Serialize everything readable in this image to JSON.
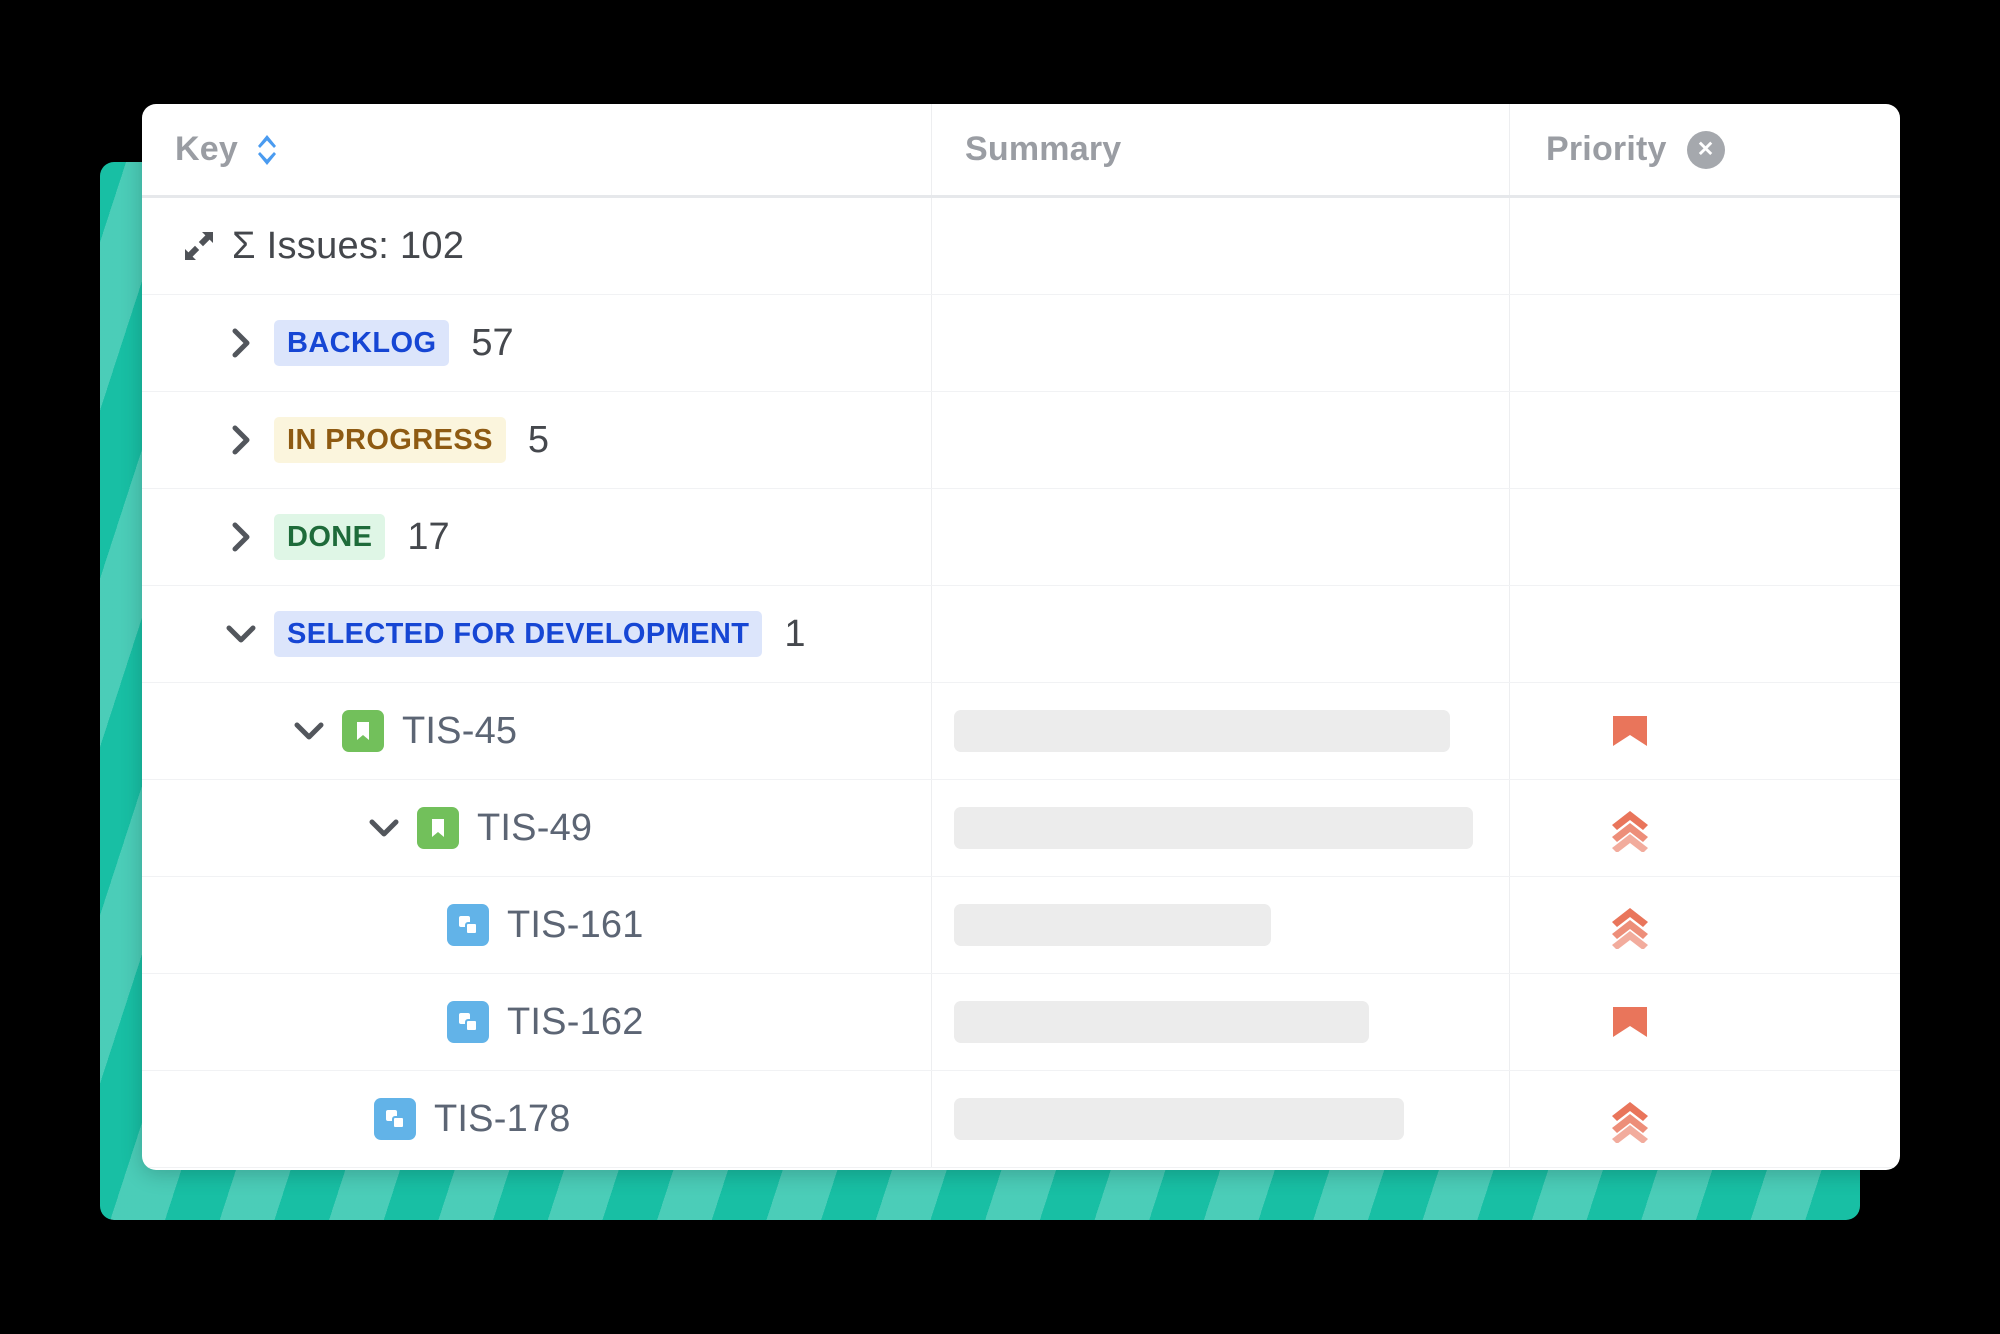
{
  "columns": {
    "key": {
      "label": "Key",
      "sort_icon": "sort-updown-icon"
    },
    "summary": {
      "label": "Summary"
    },
    "priority": {
      "label": "Priority",
      "clear_icon": "close-circle-icon",
      "clear_glyph": "✕"
    }
  },
  "summary_row": {
    "expand_icon": "expand-diagonal-icon",
    "label": "Σ Issues: 102",
    "sigma": "Σ",
    "text": "Issues:",
    "total": "102"
  },
  "status_groups": [
    {
      "name": "BACKLOG",
      "count": "57",
      "expanded": false,
      "chevron": "chevron-right-icon",
      "bg": "#DCE5FB",
      "fg": "#1646D4"
    },
    {
      "name": "IN PROGRESS",
      "count": "5",
      "expanded": false,
      "chevron": "chevron-right-icon",
      "bg": "#FBF5DD",
      "fg": "#8E5A12"
    },
    {
      "name": "DONE",
      "count": "17",
      "expanded": false,
      "chevron": "chevron-right-icon",
      "bg": "#DFF6E6",
      "fg": "#1E6B3A"
    },
    {
      "name": "SELECTED FOR DEVELOPMENT",
      "count": "1",
      "expanded": true,
      "chevron": "chevron-down-icon",
      "bg": "#DCE5FB",
      "fg": "#1646D4"
    }
  ],
  "issues": [
    {
      "key": "TIS-45",
      "type": "story",
      "type_icon": "story-bookmark-icon",
      "indent": 1,
      "chevron": "chevron-down-icon",
      "has_chevron": true,
      "summary_width_pct": 86,
      "priority": "highest",
      "priority_icon": "priority-highest-icon"
    },
    {
      "key": "TIS-49",
      "type": "story",
      "type_icon": "story-bookmark-icon",
      "indent": 2,
      "chevron": "chevron-down-icon",
      "has_chevron": true,
      "summary_width_pct": 90,
      "priority": "high",
      "priority_icon": "priority-high-icon"
    },
    {
      "key": "TIS-161",
      "type": "subtask",
      "type_icon": "subtask-squares-icon",
      "indent": 3,
      "chevron": "",
      "has_chevron": false,
      "summary_width_pct": 55,
      "priority": "high",
      "priority_icon": "priority-high-icon"
    },
    {
      "key": "TIS-162",
      "type": "subtask",
      "type_icon": "subtask-squares-icon",
      "indent": 3,
      "chevron": "",
      "has_chevron": false,
      "summary_width_pct": 72,
      "priority": "highest",
      "priority_icon": "priority-highest-icon"
    },
    {
      "key": "TIS-178",
      "type": "subtask",
      "type_icon": "subtask-squares-icon",
      "indent": 2,
      "chevron": "",
      "has_chevron": false,
      "summary_width_pct": 78,
      "priority": "high",
      "priority_icon": "priority-high-icon"
    }
  ],
  "colors": {
    "accent_teal": "#18BFA4",
    "story_green": "#72C05B",
    "subtask_blue": "#62B3E8",
    "priority_orange": "#E9755B",
    "sort_blue": "#4A9BF0",
    "skeleton_gray": "#ECECEC",
    "header_gray": "#9A9DA3"
  }
}
